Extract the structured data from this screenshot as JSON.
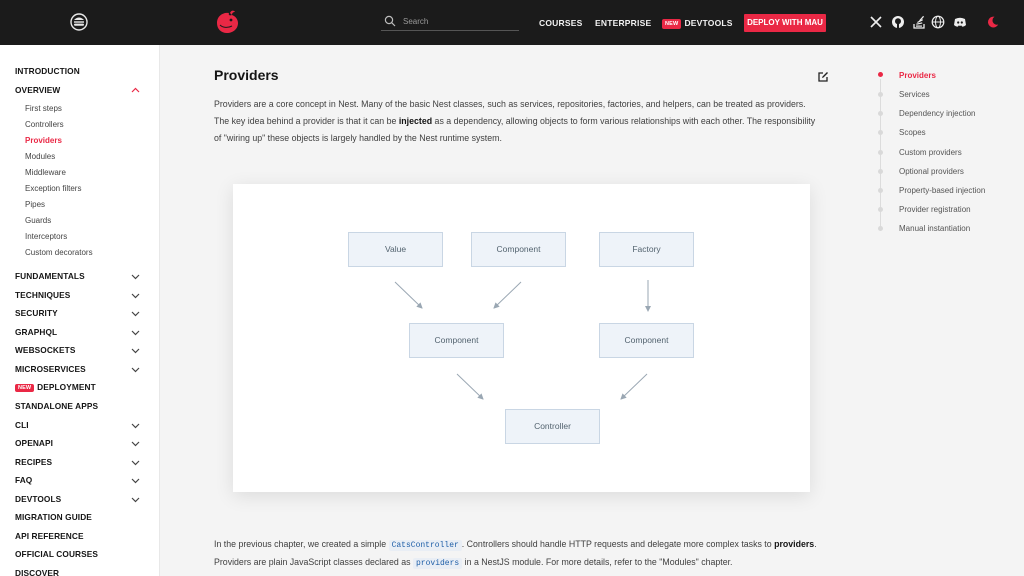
{
  "header": {
    "search_placeholder": "Search",
    "nav": [
      "COURSES",
      "ENTERPRISE",
      "DEVTOOLS"
    ],
    "new_badge": "NEW",
    "deploy_label": "DEPLOY WITH MAU",
    "icons": [
      "x-icon",
      "github-icon",
      "stackoverflow-icon",
      "globe-icon",
      "discord-icon",
      "theme-toggle-icon"
    ],
    "accent": "#ea2845"
  },
  "sidebar": {
    "sections": [
      {
        "label": "INTRODUCTION"
      },
      {
        "label": "OVERVIEW"
      },
      {
        "label": "FUNDAMENTALS"
      },
      {
        "label": "TECHNIQUES"
      },
      {
        "label": "SECURITY"
      },
      {
        "label": "GRAPHQL"
      },
      {
        "label": "WEBSOCKETS"
      },
      {
        "label": "MICROSERVICES"
      },
      {
        "label": "DEPLOYMENT",
        "badge": "NEW"
      },
      {
        "label": "STANDALONE APPS"
      },
      {
        "label": "CLI"
      },
      {
        "label": "OPENAPI"
      },
      {
        "label": "RECIPES"
      },
      {
        "label": "FAQ"
      },
      {
        "label": "DEVTOOLS"
      },
      {
        "label": "MIGRATION GUIDE"
      },
      {
        "label": "API REFERENCE"
      },
      {
        "label": "OFFICIAL COURSES"
      },
      {
        "label": "DISCOVER"
      }
    ],
    "overview_items": [
      "First steps",
      "Controllers",
      "Providers",
      "Modules",
      "Middleware",
      "Exception filters",
      "Pipes",
      "Guards",
      "Interceptors",
      "Custom decorators"
    ]
  },
  "main": {
    "title": "Providers",
    "intro_1": "Providers are a core concept in Nest. Many of the basic Nest classes, such as services, repositories, factories, and helpers, can be treated as providers. The key idea behind a provider is that it can be ",
    "intro_bold": "injected",
    "intro_2": " as a dependency, allowing objects to form various relationships with each other. The responsibility of \"wiring up\" these objects is largely handled by the Nest runtime system.",
    "diagram": {
      "value": "Value",
      "component_top": "Component",
      "factory": "Factory",
      "component_left": "Component",
      "component_right": "Component",
      "controller": "Controller"
    },
    "p2_a": "In the previous chapter, we created a simple ",
    "p2_code1": "CatsController",
    "p2_b": ". Controllers should handle HTTP requests and delegate more complex tasks to ",
    "p2_bold": "providers",
    "p2_c": ". Providers are plain JavaScript classes declared as ",
    "p2_code2": "providers",
    "p2_d": " in a NestJS module. For more details, refer to the \"Modules\" chapter."
  },
  "toc": [
    "Providers",
    "Services",
    "Dependency injection",
    "Scopes",
    "Custom providers",
    "Optional providers",
    "Property-based injection",
    "Provider registration",
    "Manual instantiation"
  ]
}
